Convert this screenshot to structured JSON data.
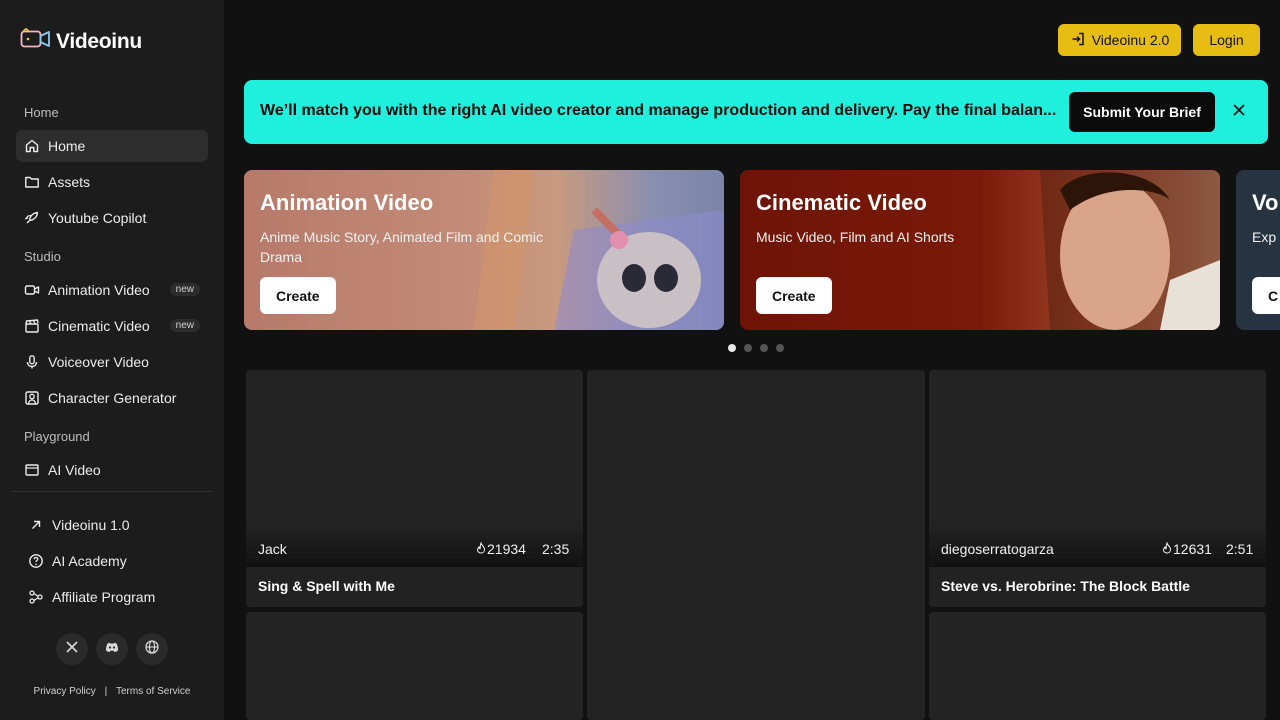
{
  "app": {
    "name": "Videoinu"
  },
  "sidebar": {
    "sections": [
      {
        "label": "Home",
        "items": [
          {
            "label": "Home",
            "icon": "home-icon",
            "active": true
          },
          {
            "label": "Assets",
            "icon": "folder-icon"
          },
          {
            "label": "Youtube Copilot",
            "icon": "rocket-icon"
          }
        ]
      },
      {
        "label": "Studio",
        "items": [
          {
            "label": "Animation Video",
            "icon": "video-camera-icon",
            "badge": "new"
          },
          {
            "label": "Cinematic Video",
            "icon": "clapperboard-icon",
            "badge": "new"
          },
          {
            "label": "Voiceover Video",
            "icon": "microphone-icon"
          },
          {
            "label": "Character Generator",
            "icon": "user-square-icon"
          }
        ]
      },
      {
        "label": "Playground",
        "items": [
          {
            "label": "AI Video",
            "icon": "film-icon"
          }
        ]
      }
    ],
    "bottom_links": [
      {
        "label": "Videoinu 1.0",
        "icon": "arrow-up-right-icon"
      },
      {
        "label": "AI Academy",
        "icon": "help-circle-icon"
      },
      {
        "label": "Affiliate Program",
        "icon": "network-icon"
      }
    ],
    "socials": [
      "x-icon",
      "discord-icon",
      "globe-icon"
    ],
    "legal": {
      "privacy": "Privacy Policy",
      "separator": "|",
      "terms": "Terms of Service"
    }
  },
  "header": {
    "version_button": "Videoinu 2.0",
    "login_button": "Login"
  },
  "banner": {
    "text": "We’ll match you with the right AI video creator and manage production and delivery. Pay the final balan...",
    "cta": "Submit Your Brief"
  },
  "hero_cards": [
    {
      "title": "Animation Video",
      "subtitle": "Anime Music Story, Animated Film and Comic Drama",
      "button": "Create"
    },
    {
      "title": "Cinematic Video",
      "subtitle": "Music Video, Film and AI Shorts",
      "button": "Create"
    },
    {
      "title": "Vo",
      "subtitle": "Exp",
      "button": "C"
    }
  ],
  "carousel": {
    "total": 4,
    "active": 1
  },
  "videos": [
    {
      "author": "Jack",
      "likes": "21934",
      "duration": "2:35",
      "title": "Sing & Spell with Me"
    },
    {
      "author": "diegoserratogarza",
      "likes": "12631",
      "duration": "2:51",
      "title": "Steve vs. Herobrine: The Block Battle"
    }
  ],
  "colors": {
    "accent_yellow": "#e6bd12",
    "banner_cyan": "#1ff0dd",
    "sidebar_bg": "#1c1c1c",
    "page_bg": "#111111"
  }
}
